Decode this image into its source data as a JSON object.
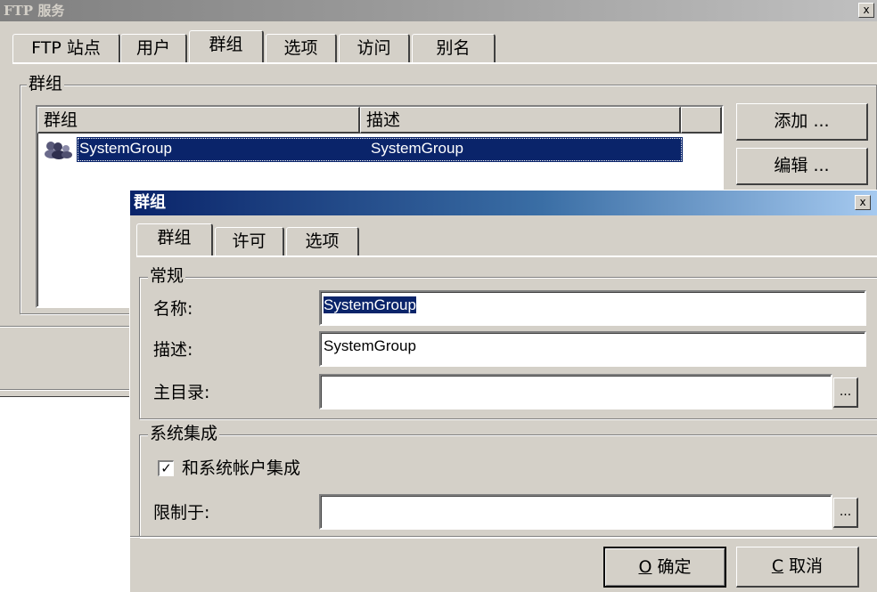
{
  "outer_window": {
    "title": "FTP 服务",
    "close_glyph": "x",
    "tabs": [
      "FTP 站点",
      "用户",
      "群组",
      "选项",
      "访问",
      "别名"
    ],
    "active_tab": "群组",
    "group_legend": "群组",
    "list": {
      "columns": [
        "群组",
        "描述"
      ],
      "rows": [
        {
          "name": "SystemGroup",
          "description": "SystemGroup",
          "selected": true,
          "icon": "group-icon"
        }
      ]
    },
    "buttons": {
      "add": "添加 ...",
      "edit": "编辑 ..."
    }
  },
  "dialog": {
    "title": "群组",
    "close_glyph": "x",
    "tabs": [
      "群组",
      "许可",
      "选项"
    ],
    "active_tab": "群组",
    "general": {
      "legend": "常规",
      "name_label": "名称:",
      "name_value": "SystemGroup",
      "desc_label": "描述:",
      "desc_value": "SystemGroup",
      "home_label": "主目录:",
      "home_value": "",
      "browse": "..."
    },
    "integration": {
      "legend": "系统集成",
      "checkbox_label": "和系统帐户集成",
      "checked": true,
      "check_glyph": "✓",
      "restrict_label": "限制于:",
      "restrict_value": "",
      "browse": "..."
    },
    "ok": {
      "mnemonic": "O",
      "label": "确定"
    },
    "cancel": {
      "mnemonic": "C",
      "label": "取消"
    }
  },
  "colors": {
    "face": "#d4d0c8",
    "selection": "#0a246a",
    "active_title": "#0a246a",
    "inactive_title": "#808080"
  }
}
